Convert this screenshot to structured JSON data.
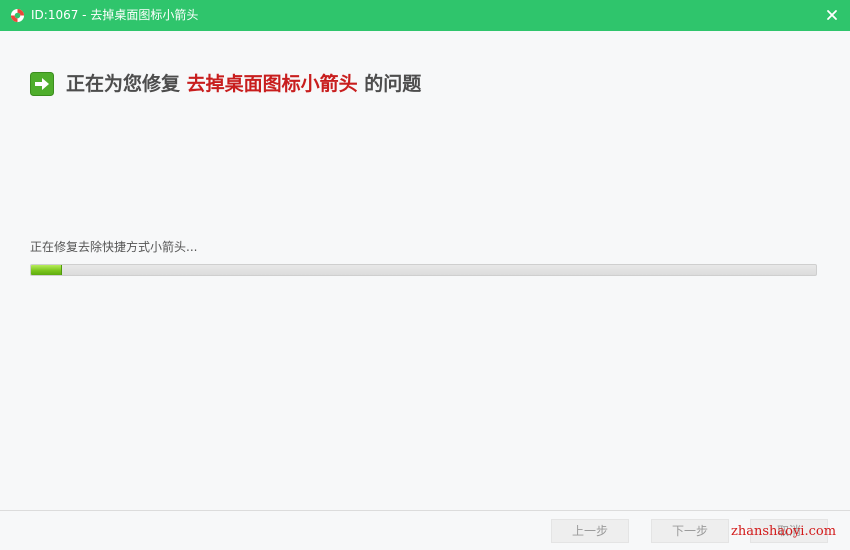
{
  "window": {
    "title": "ID:1067 - 去掉桌面图标小箭头",
    "app_icon": "lifebuoy-icon",
    "close_icon": "close-icon"
  },
  "header": {
    "icon": "green-arrow-right-icon",
    "prefix": "正在为您修复",
    "highlight": "去掉桌面图标小箭头",
    "suffix": "的问题"
  },
  "progress": {
    "status_text": "正在修复去除快捷方式小箭头...",
    "percent": 4
  },
  "footer": {
    "prev_label": "上一步",
    "next_label": "下一步",
    "cancel_label": "取消"
  },
  "watermark": {
    "text": "zhanshaoyi.com"
  },
  "colors": {
    "titlebar": "#2fc56c",
    "highlight_text": "#c81e1e",
    "progress_fill": "#7cc61e"
  }
}
